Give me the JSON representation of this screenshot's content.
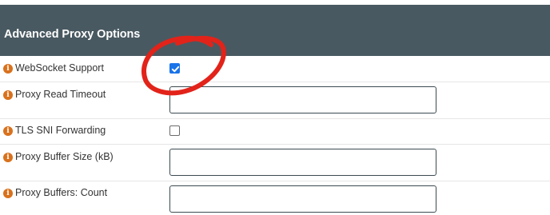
{
  "section": {
    "title": "Advanced Proxy Options"
  },
  "colors": {
    "header_bg": "#495961",
    "info_icon": "#d9711c",
    "checkbox_checked": "#1a73e8",
    "annotation": "#e2231a"
  },
  "rows": [
    {
      "label": "WebSocket Support",
      "control": "checkbox",
      "checked": true
    },
    {
      "label": "Proxy Read Timeout",
      "control": "text",
      "value": ""
    },
    {
      "label": "TLS SNI Forwarding",
      "control": "checkbox",
      "checked": false
    },
    {
      "label": "Proxy Buffer Size (kB)",
      "control": "text",
      "value": ""
    },
    {
      "label": "Proxy Buffers: Count",
      "control": "text",
      "value": ""
    }
  ],
  "icons": {
    "info": "info-circle-icon",
    "check": "checkmark-icon"
  },
  "info_glyph": "i"
}
